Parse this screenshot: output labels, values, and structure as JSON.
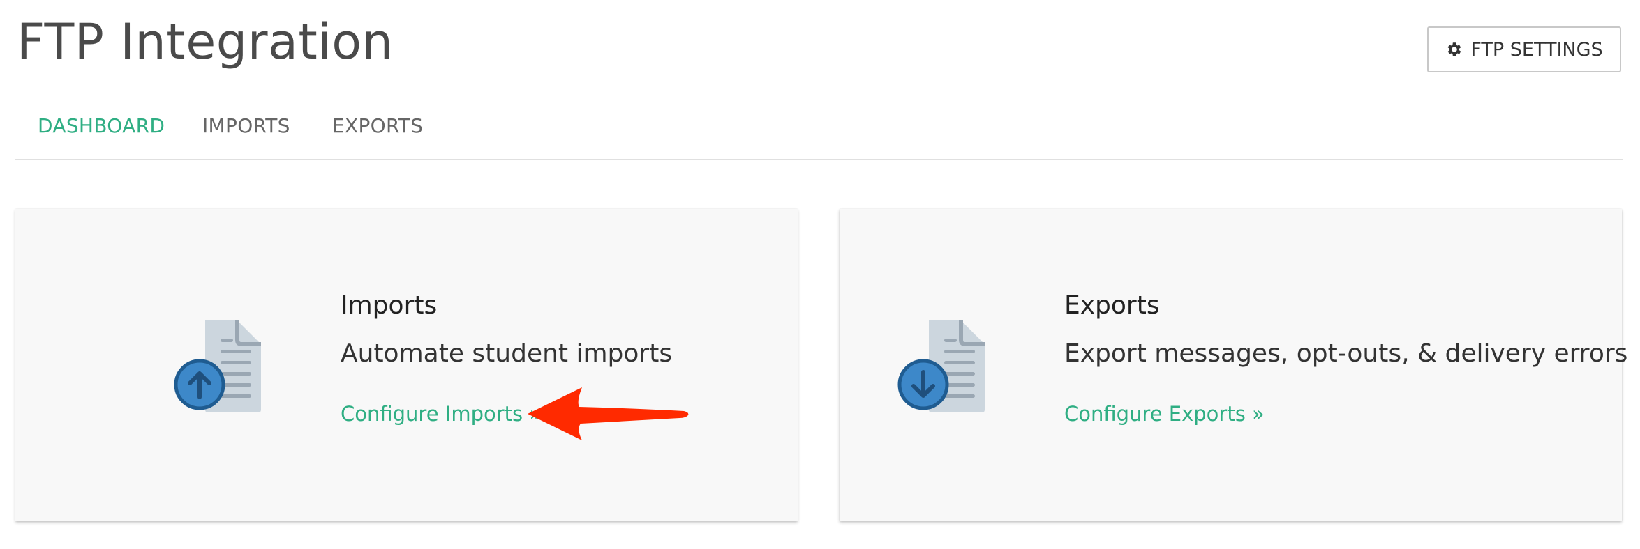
{
  "header": {
    "title": "FTP Integration",
    "settings_label": "FTP SETTINGS",
    "settings_icon": "gear-icon"
  },
  "tabs": [
    {
      "label": "DASHBOARD",
      "active": true
    },
    {
      "label": "IMPORTS",
      "active": false
    },
    {
      "label": "EXPORTS",
      "active": false
    }
  ],
  "cards": [
    {
      "title": "Imports",
      "description": "Automate student imports",
      "link": "Configure Imports »",
      "icon": "file-upload-icon"
    },
    {
      "title": "Exports",
      "description": "Export messages, opt-outs, & delivery errors",
      "link": "Configure Exports »",
      "icon": "file-download-icon"
    }
  ],
  "colors": {
    "accent": "#2fae83",
    "annotation_arrow": "#ff2a00",
    "icon_blue": "#3d88c9",
    "document_gray": "#ccd6de"
  }
}
